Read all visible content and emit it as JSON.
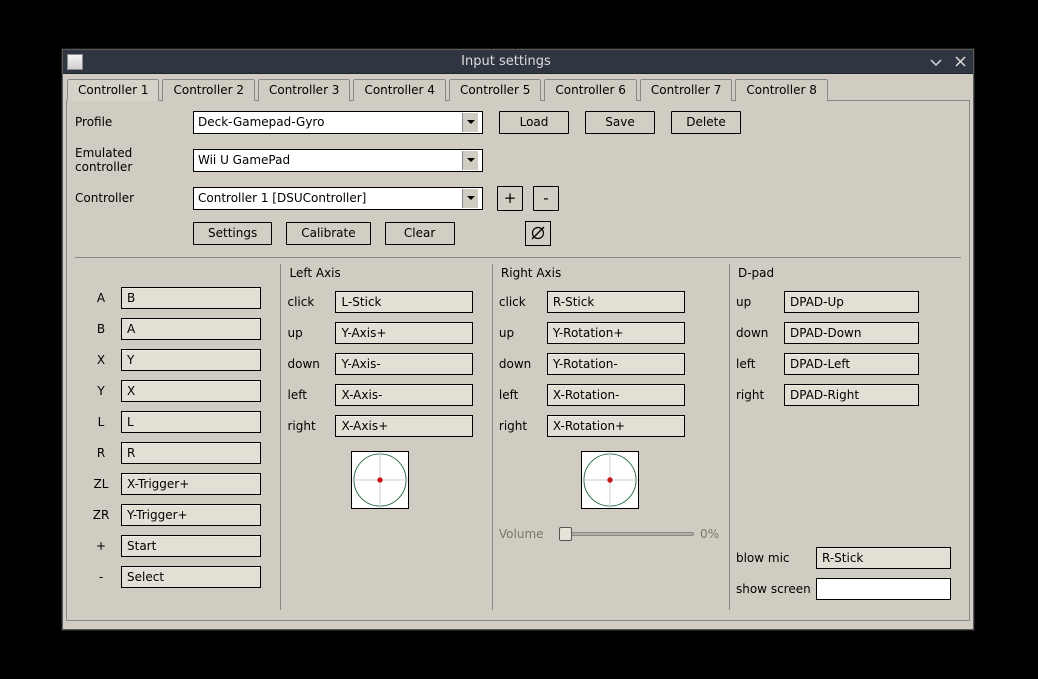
{
  "window": {
    "title": "Input settings"
  },
  "tabs": [
    "Controller 1",
    "Controller 2",
    "Controller 3",
    "Controller 4",
    "Controller 5",
    "Controller 6",
    "Controller 7",
    "Controller 8"
  ],
  "active_tab": 0,
  "top": {
    "profile_label": "Profile",
    "profile_value": "Deck-Gamepad-Gyro",
    "load": "Load",
    "save": "Save",
    "delete": "Delete",
    "emulated_label": "Emulated controller",
    "emulated_value": "Wii U GamePad",
    "controller_label": "Controller",
    "controller_value": "Controller 1 [DSUController]",
    "add": "+",
    "remove": "-",
    "settings": "Settings",
    "calibrate": "Calibrate",
    "clear": "Clear"
  },
  "buttons_panel": {
    "rows": [
      {
        "label": "A",
        "value": "B"
      },
      {
        "label": "B",
        "value": "A"
      },
      {
        "label": "X",
        "value": "Y"
      },
      {
        "label": "Y",
        "value": "X"
      },
      {
        "label": "L",
        "value": "L"
      },
      {
        "label": "R",
        "value": "R"
      },
      {
        "label": "ZL",
        "value": "X-Trigger+"
      },
      {
        "label": "ZR",
        "value": "Y-Trigger+"
      },
      {
        "label": "+",
        "value": "Start"
      },
      {
        "label": "-",
        "value": "Select"
      }
    ]
  },
  "left_axis": {
    "title": "Left Axis",
    "rows": [
      {
        "label": "click",
        "value": "L-Stick"
      },
      {
        "label": "up",
        "value": "Y-Axis+"
      },
      {
        "label": "down",
        "value": "Y-Axis-"
      },
      {
        "label": "left",
        "value": "X-Axis-"
      },
      {
        "label": "right",
        "value": "X-Axis+"
      }
    ]
  },
  "right_axis": {
    "title": "Right Axis",
    "rows": [
      {
        "label": "click",
        "value": "R-Stick"
      },
      {
        "label": "up",
        "value": "Y-Rotation+"
      },
      {
        "label": "down",
        "value": "Y-Rotation-"
      },
      {
        "label": "left",
        "value": "X-Rotation-"
      },
      {
        "label": "right",
        "value": "X-Rotation+"
      }
    ],
    "volume_label": "Volume",
    "volume_value": "0%"
  },
  "dpad": {
    "title": "D-pad",
    "rows": [
      {
        "label": "up",
        "value": "DPAD-Up"
      },
      {
        "label": "down",
        "value": "DPAD-Down"
      },
      {
        "label": "left",
        "value": "DPAD-Left"
      },
      {
        "label": "right",
        "value": "DPAD-Right"
      }
    ],
    "blow_mic_label": "blow mic",
    "blow_mic_value": "R-Stick",
    "show_screen_label": "show screen",
    "show_screen_value": ""
  }
}
